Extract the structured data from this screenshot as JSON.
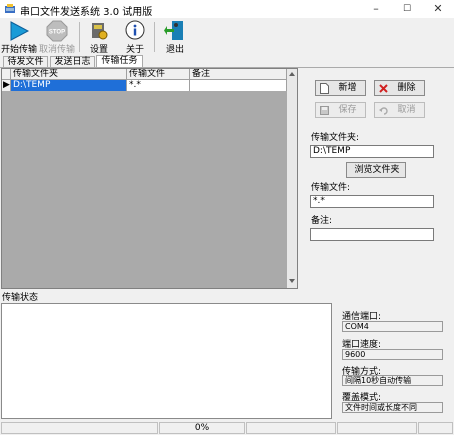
{
  "window": {
    "title": "串口文件发送系统 3.0 试用版",
    "minimize": "–",
    "maximize": "☐",
    "close": "✕"
  },
  "toolbar": {
    "start_label": "开始传输",
    "cancel_label": "取消传输",
    "stop_icon_text": "STOP",
    "settings_label": "设置",
    "about_label": "关于",
    "exit_label": "退出"
  },
  "tabs": [
    {
      "label": "待发文件"
    },
    {
      "label": "发送日志"
    },
    {
      "label": "传输任务"
    }
  ],
  "grid": {
    "columns": [
      "传输文件夹",
      "传输文件",
      "备注"
    ],
    "rows": [
      {
        "marker": "▶",
        "folder": "D:\\TEMP",
        "file": "*.*",
        "note": ""
      }
    ]
  },
  "actions": {
    "add_label": "新增",
    "delete_label": "删除",
    "save_label": "保存",
    "cancel_label": "取消"
  },
  "form": {
    "folder_label": "传输文件夹:",
    "folder_value": "D:\\TEMP",
    "browse_label": "浏览文件夹",
    "file_label": "传输文件:",
    "file_value": "*.*",
    "note_label": "备注:",
    "note_value": ""
  },
  "status": {
    "header": "传输状态",
    "port_label": "通信端口:",
    "port_value": "COM4",
    "speed_label": "端口速度:",
    "speed_value": "9600",
    "mode_label": "传输方式:",
    "mode_value": "间隔10秒自动传输",
    "overwrite_label": "覆盖模式:",
    "overwrite_value": "文件时间或长度不同"
  },
  "statusbar": {
    "progress_text": "0%"
  },
  "colors": {
    "selection": "#1f6fd8",
    "add_icon": "#ffffff",
    "delete_icon": "#d02020"
  }
}
